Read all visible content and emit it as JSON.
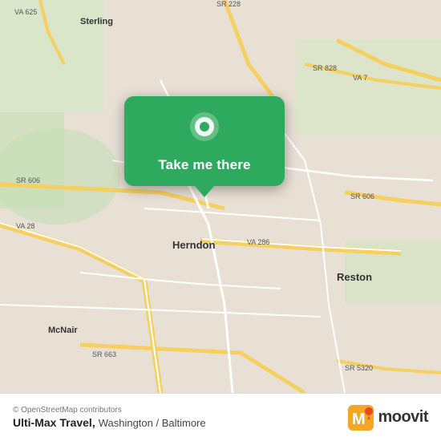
{
  "map": {
    "alt": "Map of Herndon, Washington / Baltimore area"
  },
  "popup": {
    "button_label": "Take me there",
    "icon": "location-pin"
  },
  "footer": {
    "osm_credit": "© OpenStreetMap contributors",
    "title": "Ulti-Max Travel,",
    "subtitle": "Washington / Baltimore",
    "brand": "moovit"
  }
}
